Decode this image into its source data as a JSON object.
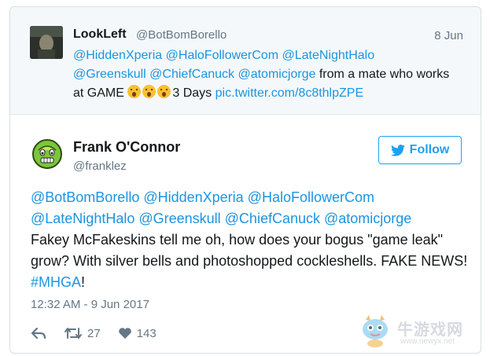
{
  "quoted_tweet": {
    "name": "LookLeft",
    "handle": "@BotBomBorello",
    "date": "8 Jun",
    "mentions_line1": "@HiddenXperia @HaloFollowerCom @LateNightHalo",
    "mentions_line2": "@Greenskull @ChiefCanuck @atomicjorge",
    "text_before_emoji": "from a mate who works at GAME",
    "text_after_emoji": "3 Days",
    "link": "pic.twitter.com/8c8thlpZPE"
  },
  "tweet": {
    "name": "Frank O'Connor",
    "handle": "@franklez",
    "follow_label": "Follow",
    "mentions_line1": "@BotBomBorello @HiddenXperia @HaloFollowerCom",
    "mentions_line2": "@LateNightHalo @Greenskull @ChiefCanuck @atomicjorge",
    "text": "Fakey McFakeskins tell me oh, how does your bogus \"game leak\" grow? With silver bells and photoshopped cockleshells. FAKE NEWS!",
    "hashtag": "#MHGA",
    "text_end": "!",
    "timestamp": "12:32 AM - 9 Jun 2017",
    "retweet_count": "27",
    "like_count": "143"
  },
  "watermark": {
    "text": "牛游戏网",
    "url": "www.newyx.net"
  },
  "colors": {
    "link": "#1b95e0",
    "follow": "#1da1f2",
    "muted": "#657786"
  }
}
